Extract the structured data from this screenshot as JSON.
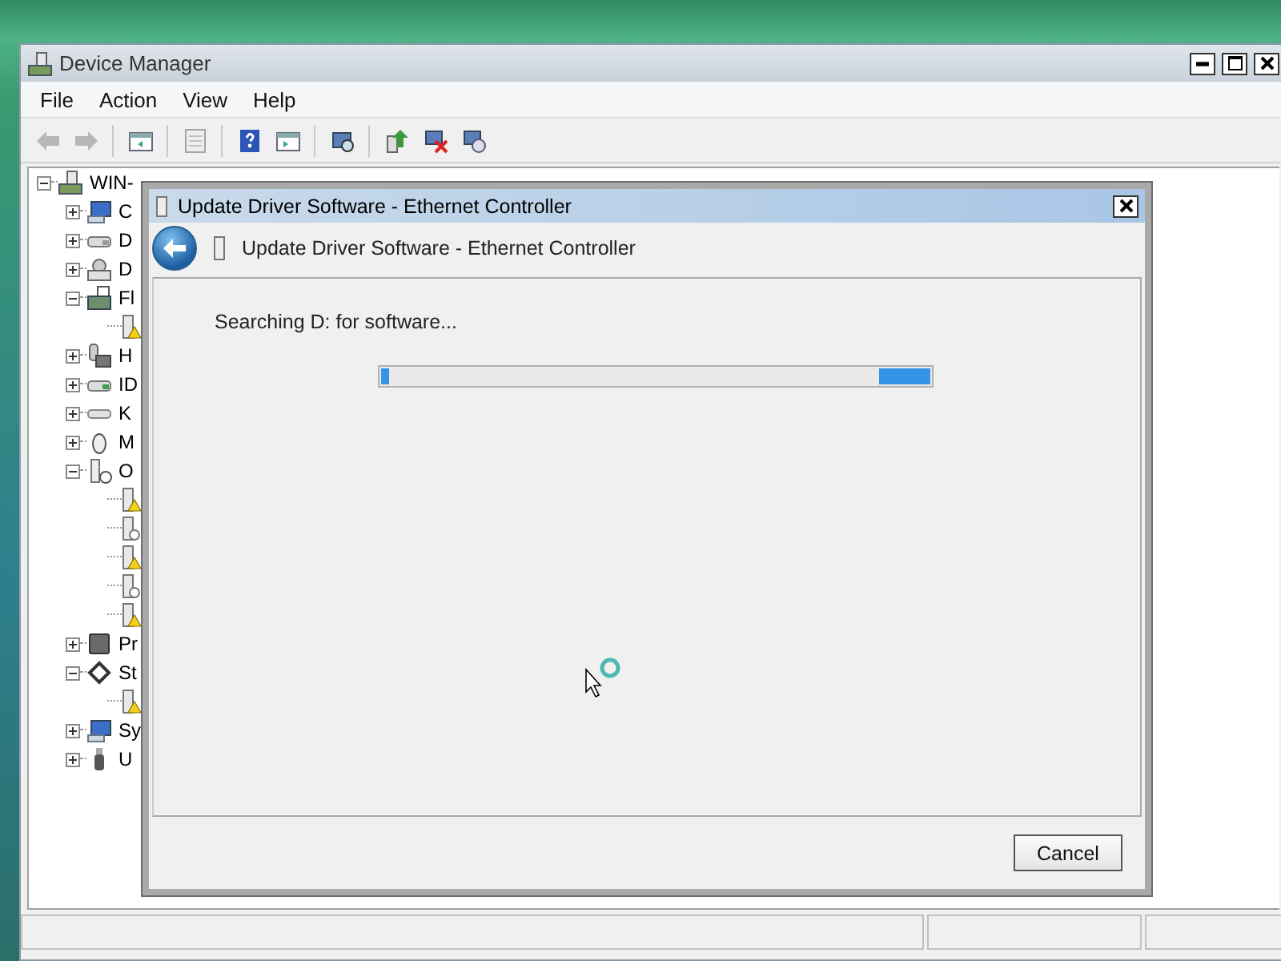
{
  "window": {
    "title": "Device Manager"
  },
  "menu": [
    "File",
    "Action",
    "View",
    "Help"
  ],
  "toolbar": [
    {
      "kind": "back",
      "disabled": true
    },
    {
      "kind": "forward",
      "disabled": true
    },
    {
      "kind": "separator"
    },
    {
      "kind": "console-tree",
      "disabled": false
    },
    {
      "kind": "separator"
    },
    {
      "kind": "properties",
      "disabled": true
    },
    {
      "kind": "separator"
    },
    {
      "kind": "help",
      "disabled": false
    },
    {
      "kind": "action-pane",
      "disabled": false
    },
    {
      "kind": "separator"
    },
    {
      "kind": "scan",
      "disabled": false
    },
    {
      "kind": "separator"
    },
    {
      "kind": "update",
      "disabled": false
    },
    {
      "kind": "uninstall",
      "disabled": false
    },
    {
      "kind": "disable",
      "disabled": false
    }
  ],
  "tree": {
    "label": "WIN-",
    "expanded": true,
    "children": [
      {
        "label": "C",
        "expanded": false
      },
      {
        "label": "D",
        "expanded": false
      },
      {
        "label": "D",
        "expanded": false
      },
      {
        "label": "Fl",
        "expanded": true,
        "children": [
          {
            "warning": true
          }
        ]
      },
      {
        "label": "H",
        "expanded": false
      },
      {
        "label": "ID",
        "expanded": false
      },
      {
        "label": "K",
        "expanded": false
      },
      {
        "label": "M",
        "expanded": false
      },
      {
        "label": "O",
        "expanded": true,
        "children": [
          {
            "warning": true
          },
          {
            "warning": false
          },
          {
            "warning": true
          },
          {
            "warning": false
          },
          {
            "warning": true
          }
        ]
      },
      {
        "label": "Pr",
        "expanded": false
      },
      {
        "label": "St",
        "expanded": true,
        "children": [
          {
            "warning": true
          }
        ]
      },
      {
        "label": "Sy",
        "expanded": false
      },
      {
        "label": "U",
        "expanded": false
      }
    ]
  },
  "dialog": {
    "title": "Update Driver Software - Ethernet Controller",
    "heading": "Update Driver Software - Ethernet Controller",
    "status": "Searching D: for software...",
    "progress": {
      "indeterminate": true
    },
    "buttons": [
      "Cancel"
    ]
  }
}
